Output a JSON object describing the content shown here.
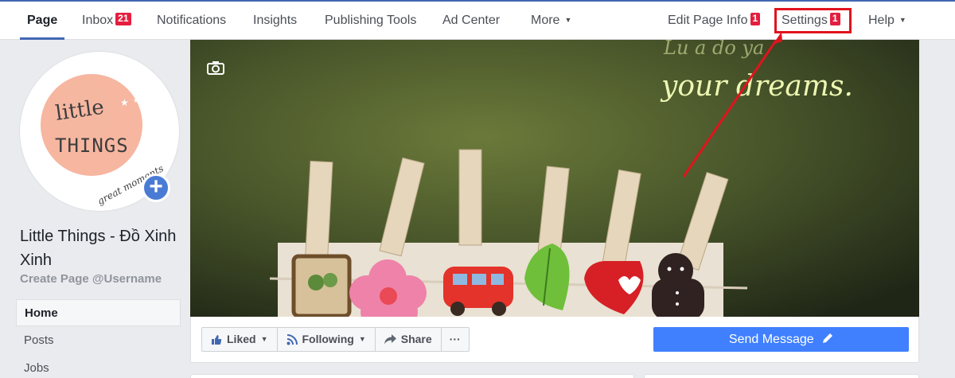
{
  "topnav": {
    "page": "Page",
    "inbox": "Inbox",
    "inbox_badge": "21",
    "notifications": "Notifications",
    "insights": "Insights",
    "publishing_tools": "Publishing Tools",
    "ad_center": "Ad Center",
    "more": "More",
    "edit_page_info": "Edit Page Info",
    "edit_page_info_badge": "1",
    "settings": "Settings",
    "settings_badge": "1",
    "help": "Help"
  },
  "profile": {
    "page_name": "Little Things - Đồ Xinh Xinh",
    "username_link": "Create Page @Username",
    "logo_text": [
      "little",
      "THINGS",
      "great moments"
    ]
  },
  "sidebar": {
    "items": [
      {
        "label": "Home",
        "active": true
      },
      {
        "label": "Posts",
        "active": false
      },
      {
        "label": "Jobs",
        "active": false
      }
    ]
  },
  "cover": {
    "overlay_text": "your dreams."
  },
  "actions": {
    "liked": "Liked",
    "following": "Following",
    "share": "Share",
    "more": "···",
    "send_message": "Send Message"
  },
  "colors": {
    "brand": "#4267b2",
    "send_button": "#4080ff",
    "badge": "#e41e3f",
    "annotation": "#e0141e"
  }
}
